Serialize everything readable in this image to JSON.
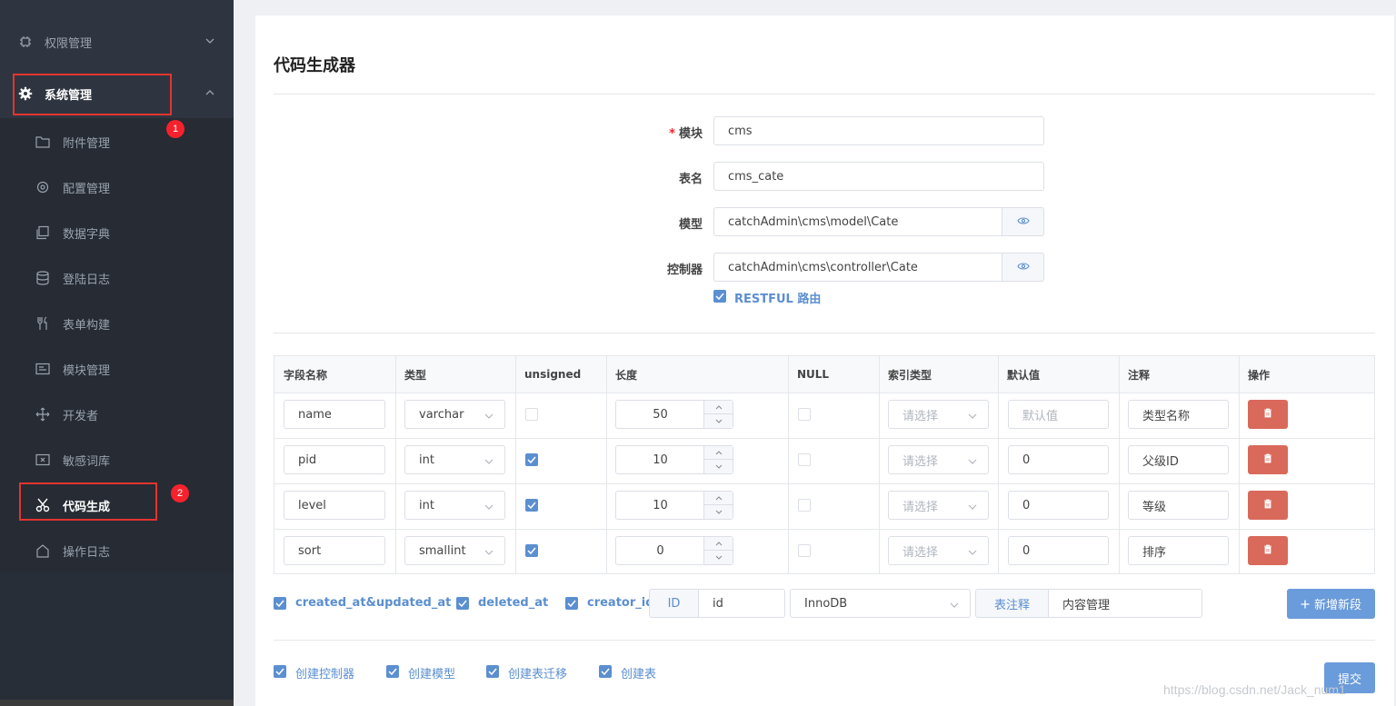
{
  "sidebar": {
    "groups": [
      {
        "label": "权限管理",
        "icon": "cpu-icon",
        "expanded": false
      },
      {
        "label": "系统管理",
        "icon": "gear-icon",
        "expanded": true
      }
    ],
    "items": [
      {
        "label": "附件管理",
        "icon": "folder-icon"
      },
      {
        "label": "配置管理",
        "icon": "settings-icon"
      },
      {
        "label": "数据字典",
        "icon": "copy-icon"
      },
      {
        "label": "登陆日志",
        "icon": "database-icon"
      },
      {
        "label": "表单构建",
        "icon": "fork-knife-icon"
      },
      {
        "label": "模块管理",
        "icon": "card-icon"
      },
      {
        "label": "开发者",
        "icon": "move-icon"
      },
      {
        "label": "敏感词库",
        "icon": "file-x-icon"
      },
      {
        "label": "代码生成",
        "icon": "scissors-icon",
        "active": true
      },
      {
        "label": "操作日志",
        "icon": "home-icon"
      }
    ],
    "badges": [
      "1",
      "2"
    ]
  },
  "page": {
    "title": "代码生成器"
  },
  "form": {
    "module_label": "模块",
    "module_value": "cms",
    "table_label": "表名",
    "table_value": "cms_cate",
    "model_label": "模型",
    "model_value": "catchAdmin\\cms\\model\\Cate",
    "controller_label": "控制器",
    "controller_value": "catchAdmin\\cms\\controller\\Cate",
    "restful_label": "RESTFUL 路由",
    "restful_checked": true
  },
  "table": {
    "headers": [
      "字段名称",
      "类型",
      "unsigned",
      "长度",
      "NULL",
      "索引类型",
      "默认值",
      "注释",
      "操作"
    ],
    "rows": [
      {
        "name": "name",
        "type": "varchar",
        "unsigned": false,
        "length": "50",
        "null": false,
        "index": "请选择",
        "default": "默认值",
        "default_is_placeholder": true,
        "comment": "类型名称"
      },
      {
        "name": "pid",
        "type": "int",
        "unsigned": true,
        "length": "10",
        "null": false,
        "index": "请选择",
        "default": "0",
        "default_is_placeholder": false,
        "comment": "父级ID"
      },
      {
        "name": "level",
        "type": "int",
        "unsigned": true,
        "length": "10",
        "null": false,
        "index": "请选择",
        "default": "0",
        "default_is_placeholder": false,
        "comment": "等级"
      },
      {
        "name": "sort",
        "type": "smallint",
        "unsigned": true,
        "length": "0",
        "null": false,
        "index": "请选择",
        "default": "0",
        "default_is_placeholder": false,
        "comment": "排序"
      }
    ]
  },
  "options": {
    "created_updated": "created_at&updated_at",
    "deleted_at": "deleted_at",
    "creator_id": "creator_id",
    "id_prefix": "ID",
    "id_value": "id",
    "engine": "InnoDB",
    "comment_prefix": "表注释",
    "comment_value": "内容管理",
    "add_field_button": "新增新段"
  },
  "create": {
    "controller": "创建控制器",
    "model": "创建模型",
    "migration": "创建表迁移",
    "table": "创建表",
    "submit": "提交"
  },
  "watermark": "https://blog.csdn.net/Jack_num1",
  "colors": {
    "sidebar_bg": "#2f3540",
    "accent": "#5b8fd0",
    "danger": "#d9695a",
    "highlight_box": "#e3342f"
  }
}
